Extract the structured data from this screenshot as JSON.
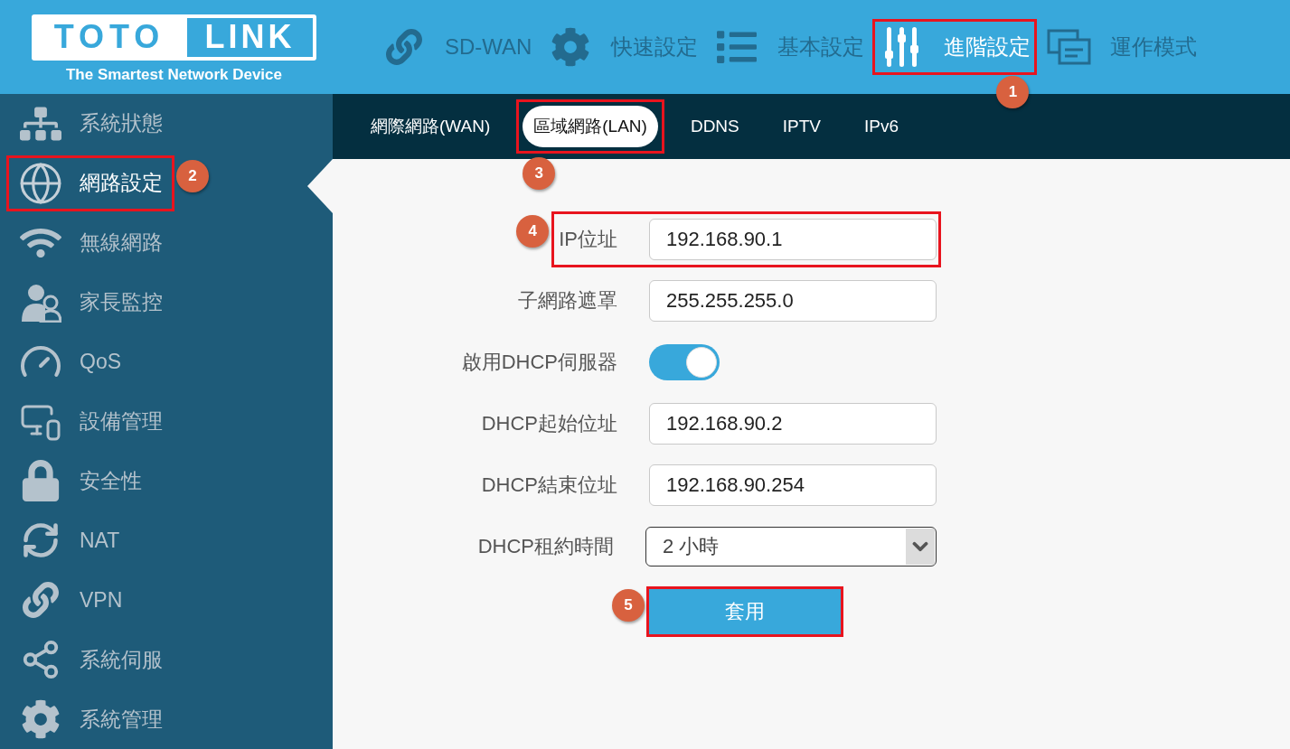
{
  "header": {
    "logo": {
      "left": "TOTO",
      "right": "LINK",
      "tagline": "The Smartest Network Device"
    },
    "nav": [
      {
        "label": "SD-WAN",
        "selected": false,
        "highlighted": false
      },
      {
        "label": "快速設定",
        "selected": false,
        "highlighted": false
      },
      {
        "label": "基本設定",
        "selected": false,
        "highlighted": false
      },
      {
        "label": "進階設定",
        "selected": true,
        "highlighted": true,
        "callout": "1"
      },
      {
        "label": "運作模式",
        "selected": false,
        "highlighted": false
      }
    ]
  },
  "sidebar": {
    "items": [
      {
        "label": "系統狀態",
        "selected": false,
        "highlighted": false
      },
      {
        "label": "網路設定",
        "selected": true,
        "highlighted": true,
        "callout": "2"
      },
      {
        "label": "無線網路",
        "selected": false,
        "highlighted": false
      },
      {
        "label": "家長監控",
        "selected": false,
        "highlighted": false
      },
      {
        "label": "QoS",
        "selected": false,
        "highlighted": false
      },
      {
        "label": "設備管理",
        "selected": false,
        "highlighted": false
      },
      {
        "label": "安全性",
        "selected": false,
        "highlighted": false
      },
      {
        "label": "NAT",
        "selected": false,
        "highlighted": false
      },
      {
        "label": "VPN",
        "selected": false,
        "highlighted": false
      },
      {
        "label": "系統伺服",
        "selected": false,
        "highlighted": false
      },
      {
        "label": "系統管理",
        "selected": false,
        "highlighted": false
      }
    ]
  },
  "tabs": [
    {
      "label": "網際網路(WAN)",
      "selected": false,
      "highlighted": false
    },
    {
      "label": "區域網路(LAN)",
      "selected": true,
      "highlighted": true,
      "callout": "3"
    },
    {
      "label": "DDNS",
      "selected": false,
      "highlighted": false
    },
    {
      "label": "IPTV",
      "selected": false,
      "highlighted": false
    },
    {
      "label": "IPv6",
      "selected": false,
      "highlighted": false
    }
  ],
  "form": {
    "fields": [
      {
        "kind": "text",
        "label": "IP位址",
        "value": "192.168.90.1",
        "highlighted": true,
        "callout": "4"
      },
      {
        "kind": "text",
        "label": "子網路遮罩",
        "value": "255.255.255.0",
        "highlighted": false
      },
      {
        "kind": "toggle",
        "label": "啟用DHCP伺服器",
        "on": true,
        "highlighted": false
      },
      {
        "kind": "text",
        "label": "DHCP起始位址",
        "value": "192.168.90.2",
        "highlighted": false
      },
      {
        "kind": "text",
        "label": "DHCP結束位址",
        "value": "192.168.90.254",
        "highlighted": false
      },
      {
        "kind": "select",
        "label": "DHCP租約時間",
        "value": "2 小時",
        "highlighted": false
      }
    ],
    "apply": {
      "label": "套用",
      "highlighted": true,
      "callout": "5"
    }
  }
}
